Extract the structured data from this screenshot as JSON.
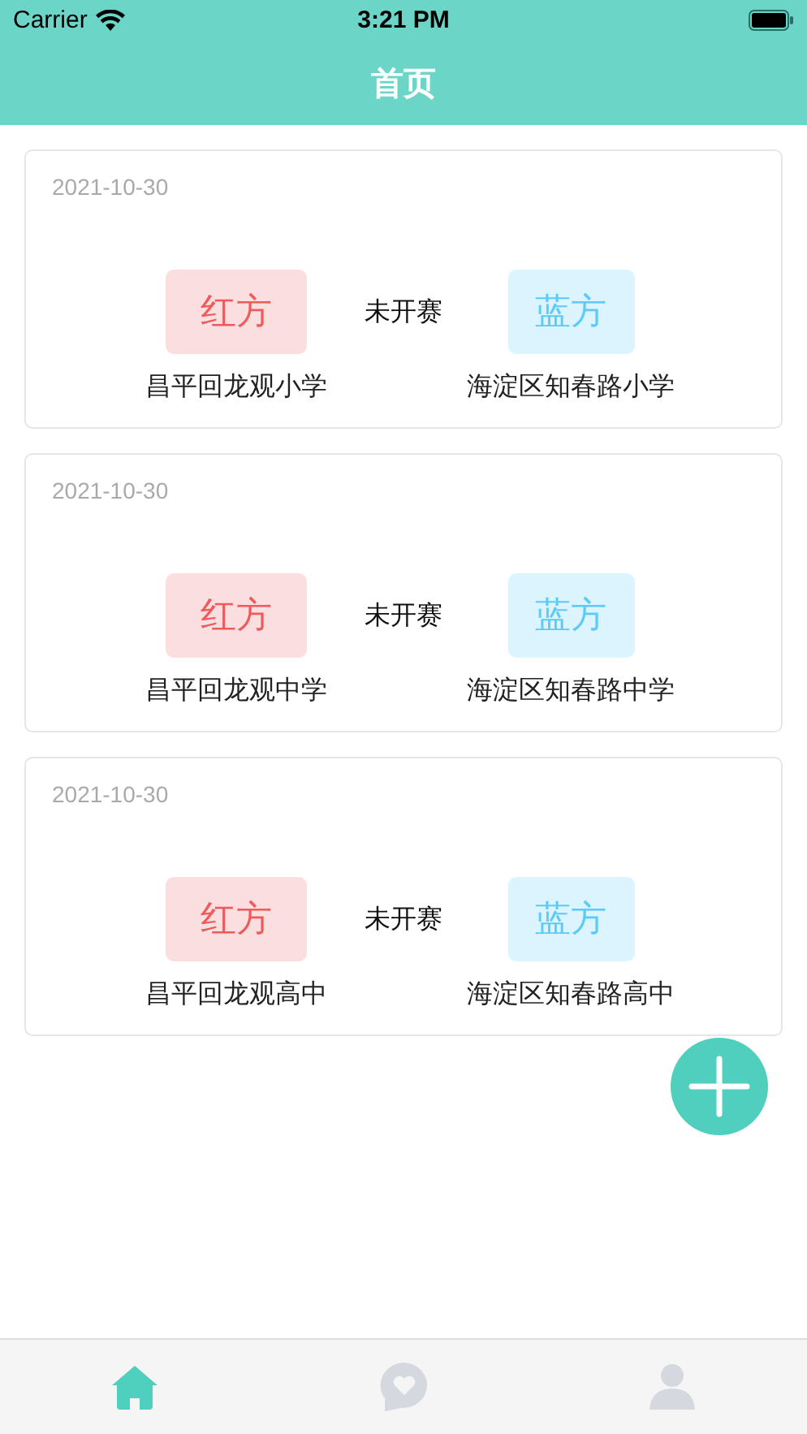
{
  "status_bar": {
    "carrier": "Carrier",
    "time": "3:21 PM"
  },
  "nav": {
    "title": "首页"
  },
  "matches": [
    {
      "date": "2021-10-30",
      "red": {
        "label": "红方",
        "school": "昌平回龙观小学"
      },
      "status": "未开赛",
      "blue": {
        "label": "蓝方",
        "school": "海淀区知春路小学"
      }
    },
    {
      "date": "2021-10-30",
      "red": {
        "label": "红方",
        "school": "昌平回龙观中学"
      },
      "status": "未开赛",
      "blue": {
        "label": "蓝方",
        "school": "海淀区知春路中学"
      }
    },
    {
      "date": "2021-10-30",
      "red": {
        "label": "红方",
        "school": "昌平回龙观高中"
      },
      "status": "未开赛",
      "blue": {
        "label": "蓝方",
        "school": "海淀区知春路高中"
      }
    }
  ],
  "tabs": [
    {
      "kind": "home",
      "selected": true
    },
    {
      "kind": "chat",
      "selected": false
    },
    {
      "kind": "profile",
      "selected": false
    }
  ]
}
